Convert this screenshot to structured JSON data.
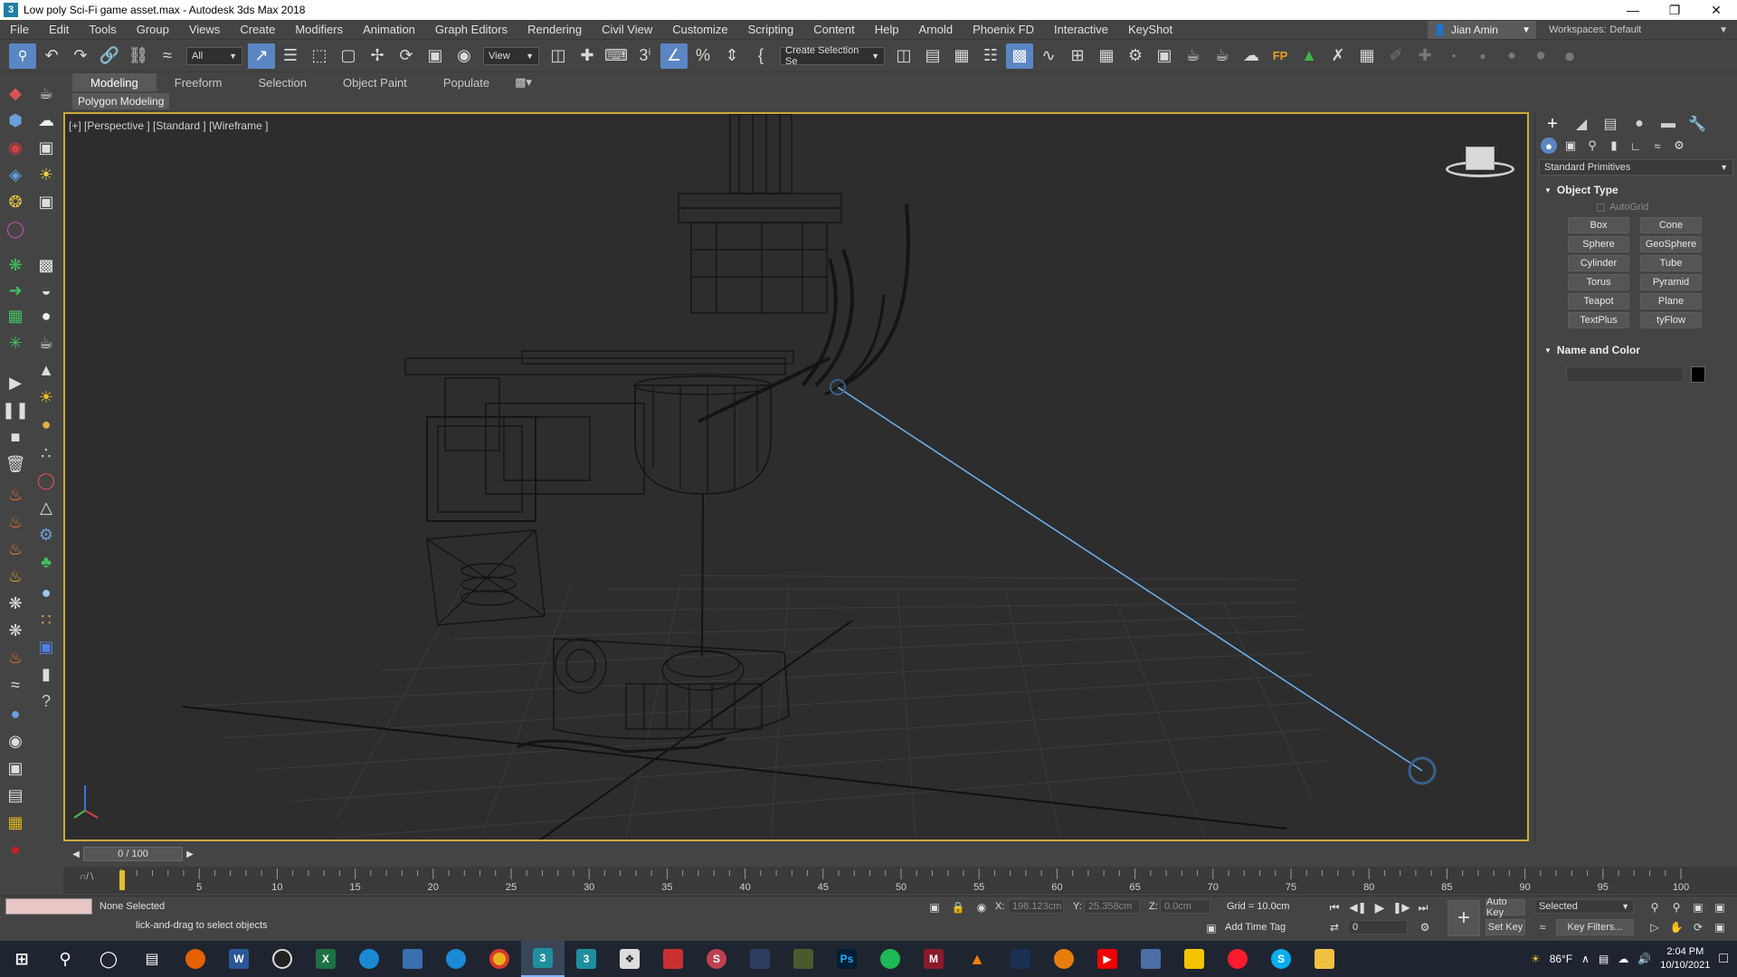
{
  "window": {
    "title": "Low poly Sci-Fi game asset.max - Autodesk 3ds Max 2018",
    "app_icon": "3",
    "controls": [
      "minimize",
      "maximize",
      "close"
    ]
  },
  "menu": {
    "items": [
      "File",
      "Edit",
      "Tools",
      "Group",
      "Views",
      "Create",
      "Modifiers",
      "Animation",
      "Graph Editors",
      "Rendering",
      "Civil View",
      "Customize",
      "Scripting",
      "Content",
      "Help",
      "Arnold",
      "Phoenix FD",
      "Interactive",
      "KeyShot"
    ],
    "user": "Jian Amin",
    "workspace_label": "Workspaces:",
    "workspace_value": "Default"
  },
  "toolbar": {
    "filter": "All",
    "coord": "View",
    "selection_set": "Create Selection Se"
  },
  "ribbon": {
    "tabs": [
      "Modeling",
      "Freeform",
      "Selection",
      "Object Paint",
      "Populate"
    ],
    "active_tab": "Modeling",
    "sub_label": "Polygon Modeling"
  },
  "viewport": {
    "label": "[+] [Perspective ] [Standard ] [Wireframe ]"
  },
  "command_panel": {
    "category": "Standard Primitives",
    "object_type_title": "Object Type",
    "autogrid": "AutoGrid",
    "buttons": [
      "Box",
      "Cone",
      "Sphere",
      "GeoSphere",
      "Cylinder",
      "Tube",
      "Torus",
      "Pyramid",
      "Teapot",
      "Plane",
      "TextPlus",
      "tyFlow"
    ],
    "name_color_title": "Name and Color"
  },
  "time": {
    "frame_display": "0 / 100",
    "ticks": [
      "5",
      "10",
      "15",
      "20",
      "25",
      "30",
      "35",
      "40",
      "45",
      "50",
      "55",
      "60",
      "65",
      "70",
      "75",
      "80",
      "85",
      "90",
      "95",
      "100"
    ]
  },
  "status": {
    "selection": "None Selected",
    "prompt": "lick-and-drag to select objects",
    "x_label": "X:",
    "x_value": "198.123cm",
    "y_label": "Y:",
    "y_value": "25.358cm",
    "z_label": "Z:",
    "z_value": "0.0cm",
    "grid": "Grid = 10.0cm",
    "add_time_tag": "Add Time Tag",
    "auto_key": "Auto Key",
    "set_key": "Set Key",
    "key_mode": "Selected",
    "key_filters": "Key Filters...",
    "current_frame": "0"
  },
  "taskbar": {
    "weather": "86°F",
    "time": "2:04 PM",
    "date": "10/10/2021"
  }
}
